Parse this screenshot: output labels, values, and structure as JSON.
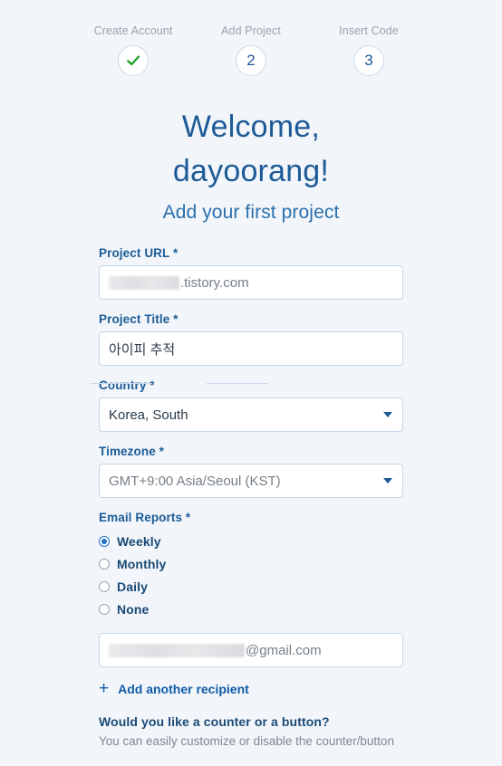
{
  "stepper": {
    "steps": [
      {
        "label": "Create Account",
        "marker": "check",
        "state": "completed"
      },
      {
        "label": "Add Project",
        "marker": "2",
        "state": "current"
      },
      {
        "label": "Insert Code",
        "marker": "3",
        "state": "upcoming"
      }
    ]
  },
  "header": {
    "welcome_line1": "Welcome,",
    "welcome_line2": "dayoorang!",
    "subtitle": "Add your first project"
  },
  "form": {
    "project_url": {
      "label": "Project URL *",
      "redacted": true,
      "value_suffix": ".tistory.com"
    },
    "project_title": {
      "label": "Project Title *",
      "value": "아이피 추적"
    },
    "country": {
      "label": "Country *",
      "value": "Korea, South"
    },
    "timezone": {
      "label": "Timezone *",
      "value": "GMT+9:00 Asia/Seoul (KST)"
    },
    "email_reports": {
      "label": "Email Reports *",
      "options": [
        {
          "label": "Weekly",
          "selected": true
        },
        {
          "label": "Monthly",
          "selected": false
        },
        {
          "label": "Daily",
          "selected": false
        },
        {
          "label": "None",
          "selected": false
        }
      ]
    },
    "recipient_email": {
      "redacted": true,
      "value_suffix": "@gmail.com"
    },
    "add_recipient": {
      "icon": "plus-icon",
      "label": "Add another recipient"
    },
    "counter_section": {
      "question": "Would you like a counter or a button?",
      "description": "You can easily customize or disable the counter/button"
    }
  },
  "colors": {
    "background": "#f2f6fb",
    "heading": "#1d5a96",
    "label": "#1b5b95",
    "accent": "#0f5ba7",
    "check": "#1aa521",
    "border": "#c4d5e6"
  }
}
